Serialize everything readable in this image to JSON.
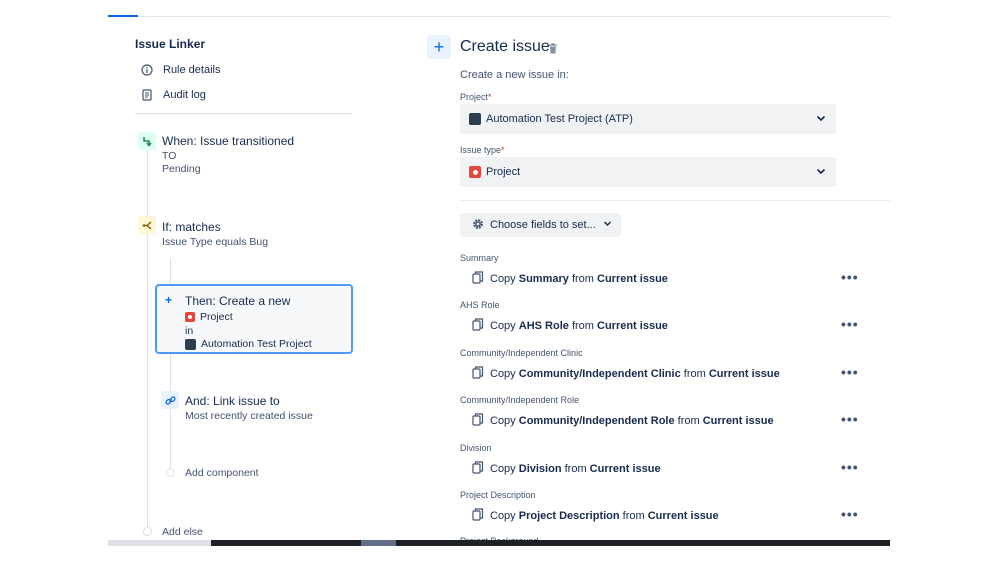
{
  "left": {
    "rule_name": "Issue Linker",
    "nav": [
      {
        "label": "Rule details",
        "icon": "info-icon"
      },
      {
        "label": "Audit log",
        "icon": "document-icon"
      }
    ],
    "when": {
      "title": "When: Issue transitioned",
      "line1": "TO",
      "line2": "Pending"
    },
    "if": {
      "title": "If: matches",
      "sub": "Issue Type equals Bug"
    },
    "then": {
      "title": "Then: Create a new",
      "type": "Project",
      "in": "in",
      "project": "Automation Test Project"
    },
    "and": {
      "title": "And: Link issue to",
      "sub": "Most recently created issue"
    },
    "add_component": "Add component",
    "add_else": "Add else"
  },
  "right": {
    "title": "Create issue",
    "subtitle": "Create a new issue in:",
    "project_label": "Project",
    "project_value": "Automation Test Project (ATP)",
    "issue_type_label": "Issue type",
    "issue_type_value": "Project",
    "required_mark": "*",
    "choose_fields": "Choose fields to set...",
    "copy_word": "Copy",
    "from_word": "from",
    "current_issue": "Current issue",
    "more_glyph": "•••",
    "fields": [
      {
        "label": "Summary",
        "field": "Summary"
      },
      {
        "label": "AHS Role",
        "field": "AHS Role"
      },
      {
        "label": "Community/Independent Clinic",
        "field": "Community/Independent Clinic"
      },
      {
        "label": "Community/Independent Role",
        "field": "Community/Independent Role"
      },
      {
        "label": "Division",
        "field": "Division"
      },
      {
        "label": "Project Description",
        "field": "Project Description"
      }
    ],
    "next_field_label": "Project Background"
  },
  "colors": {
    "accent": "#0c66e4",
    "trigger_icon_bg": "#dcfff1",
    "condition_icon_bg": "#fff7d6",
    "project_type_red": "#e2483d",
    "selected_border": "#4c9aff"
  }
}
